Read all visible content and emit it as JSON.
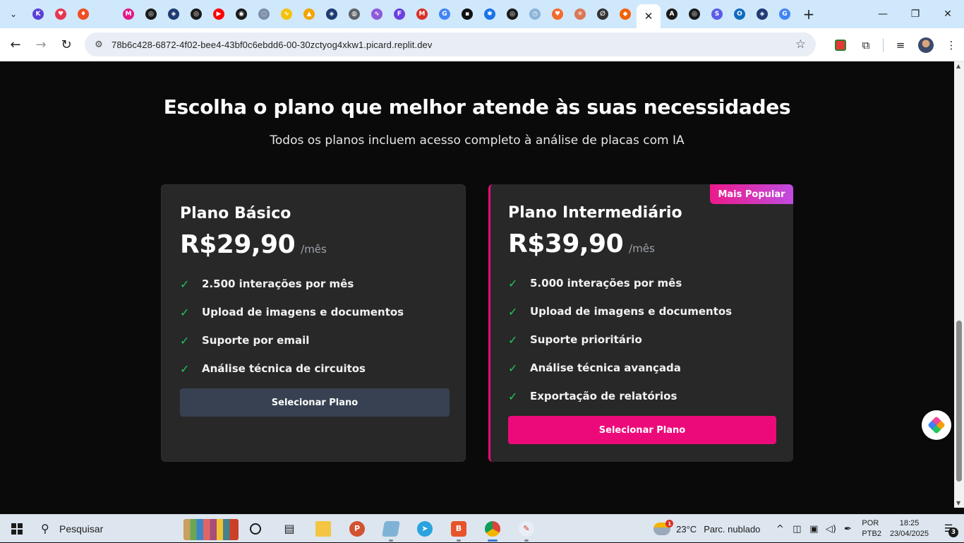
{
  "browser": {
    "tabs": [
      {
        "icon": "kanban-icon",
        "letter": "K",
        "color": "#5b3fd8"
      },
      {
        "icon": "heart-app-icon",
        "letter": "♥",
        "color": "#e8364f"
      },
      {
        "icon": "flame-icon",
        "letter": "♦",
        "color": "#f04e23"
      },
      {
        "icon": "blank-page-icon",
        "letter": "",
        "color": "#cfe8fc"
      },
      {
        "icon": "miro-icon",
        "letter": "M",
        "color": "#e21a88"
      },
      {
        "icon": "openai-icon",
        "letter": "◎",
        "color": "#1b1b1b"
      },
      {
        "icon": "copilot-icon",
        "letter": "◈",
        "color": "#1f3b73"
      },
      {
        "icon": "openai-icon-2",
        "letter": "◎",
        "color": "#1b1b1b"
      },
      {
        "icon": "youtube-icon",
        "letter": "▶",
        "color": "#ff0000"
      },
      {
        "icon": "bot-icon",
        "letter": "◉",
        "color": "#1b1b1b"
      },
      {
        "icon": "chart-tool-icon",
        "letter": "◌",
        "color": "#7d8fa8"
      },
      {
        "icon": "make-icon",
        "letter": "∿",
        "color": "#f4c20d"
      },
      {
        "icon": "drive-icon",
        "letter": "▲",
        "color": "#f4a300"
      },
      {
        "icon": "copilot-icon-2",
        "letter": "◈",
        "color": "#1f3b73"
      },
      {
        "icon": "globe-icon",
        "letter": "◍",
        "color": "#5f6368"
      },
      {
        "icon": "make-purple-icon",
        "letter": "∿",
        "color": "#8e5ad9"
      },
      {
        "icon": "framer-icon",
        "letter": "F",
        "color": "#6b3fe0"
      },
      {
        "icon": "gmail-icon",
        "letter": "M",
        "color": "#d93025"
      },
      {
        "icon": "google-icon",
        "letter": "G",
        "color": "#4285f4"
      },
      {
        "icon": "terminal-icon",
        "letter": "▪",
        "color": "#111111"
      },
      {
        "icon": "blue-gear-icon",
        "letter": "✱",
        "color": "#1a73e8"
      },
      {
        "icon": "openai-icon-3",
        "letter": "◎",
        "color": "#1b1b1b"
      },
      {
        "icon": "clock-tool-icon",
        "letter": "◷",
        "color": "#8ab4d8"
      },
      {
        "icon": "lovable-icon",
        "letter": "♥",
        "color": "#f46a2b"
      },
      {
        "icon": "claude-icon",
        "letter": "✳",
        "color": "#d97757"
      },
      {
        "icon": "cursor-icon",
        "letter": "∅",
        "color": "#333333"
      },
      {
        "icon": "replit-icon",
        "letter": "◆",
        "color": "#f26207"
      }
    ],
    "tabs_after": [
      {
        "icon": "anthropic-icon",
        "letter": "A",
        "color": "#1b1b1b"
      },
      {
        "icon": "openai-icon-4",
        "letter": "◎",
        "color": "#1b1b1b"
      },
      {
        "icon": "s-app-icon",
        "letter": "S",
        "color": "#5b5be8"
      },
      {
        "icon": "outlook-icon",
        "letter": "O",
        "color": "#0f6cbd"
      },
      {
        "icon": "copilot-icon-3",
        "letter": "◈",
        "color": "#1f3b73"
      },
      {
        "icon": "google-icon-2",
        "letter": "G",
        "color": "#4285f4"
      }
    ],
    "url": "78b6c428-6872-4f02-bee4-43bf0c6ebdd6-00-30zctyog4xkw1.picard.replit.dev"
  },
  "page": {
    "headline": "Escolha o plano que melhor atende às suas necessidades",
    "subheadline": "Todos os planos incluem acesso completo à análise de placas com IA",
    "plans": [
      {
        "name": "Plano Básico",
        "price": "R$29,90",
        "period": "/mês",
        "features": [
          "2.500 interações por mês",
          "Upload de imagens e documentos",
          "Suporte por email",
          "Análise técnica de circuitos"
        ],
        "button": "Selecionar Plano"
      },
      {
        "name": "Plano Intermediário",
        "badge": "Mais Popular",
        "price": "R$39,90",
        "period": "/mês",
        "features": [
          "5.000 interações por mês",
          "Upload de imagens e documentos",
          "Suporte prioritário",
          "Análise técnica avançada",
          "Exportação de relatórios"
        ],
        "button": "Selecionar Plano"
      }
    ],
    "accent_color": "#ec0a7a",
    "check_color": "#22c55e"
  },
  "taskbar": {
    "search_placeholder": "Pesquisar",
    "weather_temp": "23°C",
    "weather_condition": "Parc. nublado",
    "weather_badge": "1",
    "lang_line1": "POR",
    "lang_line2": "PTB2",
    "time": "18:25",
    "date": "23/04/2025",
    "notifications": "3"
  }
}
